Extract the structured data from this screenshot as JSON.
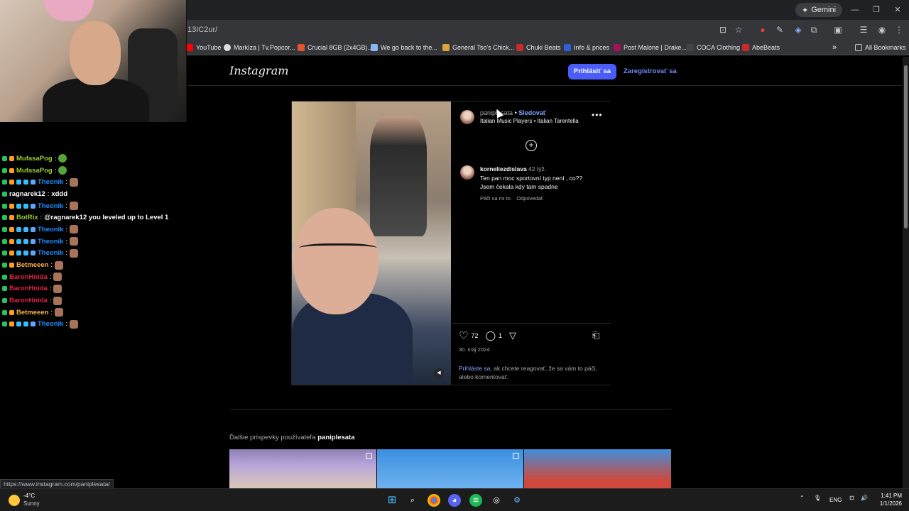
{
  "browser": {
    "gemini_label": "Gemini",
    "url": "13IC2ur/",
    "status_url": "https://www.instagram.com/paniplesata/",
    "bookmarks": [
      {
        "label": "YouTube",
        "color": "#ff0000"
      },
      {
        "label": "Markíza | Tv.Popcor...",
        "color": "#dddddd"
      },
      {
        "label": "Crucial 8GB (2x4GB)...",
        "color": "#e2552c"
      },
      {
        "label": "We go back to the...",
        "color": "#8ab4f8"
      },
      {
        "label": "General Tso's Chick...",
        "color": "#d9a441"
      },
      {
        "label": "Chuki Beats",
        "color": "#c92a2a"
      },
      {
        "label": "Info & prices",
        "color": "#2d5fd3"
      },
      {
        "label": "Post Malone | Drake...",
        "color": "#a5125c"
      },
      {
        "label": "COCA Clothing",
        "color": "#444444"
      },
      {
        "label": "AbeBeats",
        "color": "#c92a2a"
      }
    ],
    "all_bookmarks": "All Bookmarks"
  },
  "chat": [
    {
      "user": "MufasaPog",
      "color": "#9acd32",
      "msg": "",
      "emote": "green"
    },
    {
      "user": "MufasaPog",
      "color": "#9acd32",
      "msg": "",
      "emote": "green"
    },
    {
      "user": "Theonik",
      "color": "#1e90ff",
      "msg": "",
      "emote": "face"
    },
    {
      "user": "ragnarek12",
      "color": "#ffffff",
      "msg": "xddd",
      "emote": ""
    },
    {
      "user": "Theonik",
      "color": "#1e90ff",
      "msg": "",
      "emote": "face"
    },
    {
      "user": "BotRix",
      "color": "#9acd32",
      "msg": "@ragnarek12 you leveled up to Level 1",
      "emote": ""
    },
    {
      "user": "Theonik",
      "color": "#1e90ff",
      "msg": "",
      "emote": "face"
    },
    {
      "user": "Theonik",
      "color": "#1e90ff",
      "msg": "",
      "emote": "face"
    },
    {
      "user": "Theonik",
      "color": "#1e90ff",
      "msg": "",
      "emote": "face"
    },
    {
      "user": "Betmeeen",
      "color": "#ffb347",
      "msg": "",
      "emote": "face"
    },
    {
      "user": "BaronHnida",
      "color": "#e0224a",
      "msg": "",
      "emote": "face"
    },
    {
      "user": "BaronHnida",
      "color": "#e0224a",
      "msg": "",
      "emote": "face"
    },
    {
      "user": "BaronHnida",
      "color": "#e0224a",
      "msg": "",
      "emote": "face"
    },
    {
      "user": "Betmeeen",
      "color": "#ffb347",
      "msg": "",
      "emote": "face"
    },
    {
      "user": "Theonik",
      "color": "#1e90ff",
      "msg": "",
      "emote": "face"
    }
  ],
  "instagram": {
    "logo": "Instagram",
    "login_button": "Prihlásiť sa",
    "signup_link": "Zaregistrovať sa",
    "post": {
      "owner": "paniplesata",
      "follow": "Sledovať",
      "audio": "Italian Music Players • Italian Tarentella",
      "comment_user": "korneliezdislava",
      "comment_time": "42 týž.",
      "comment_text_1": "Ten pan moc sportovní typ není , co??",
      "comment_text_2": "Jsem čekala kdy tam spadne",
      "comment_like": "Páči sa mi to",
      "comment_reply": "Odpovedať",
      "likes": "72",
      "comments": "1",
      "date": "30. máj 2024",
      "login_link": "Prihláste sa",
      "login_prompt": ", ak chcete reagovať, že sa vám to páči, alebo komentovať."
    },
    "more_posts_prefix": "Ďalšie príspevky používateľa",
    "more_posts_user": "paniplesata"
  },
  "taskbar": {
    "temp": "-4°C",
    "weather": "Sunny",
    "lang": "ENG",
    "time": "1:41 PM",
    "date": "1/1/2026"
  }
}
